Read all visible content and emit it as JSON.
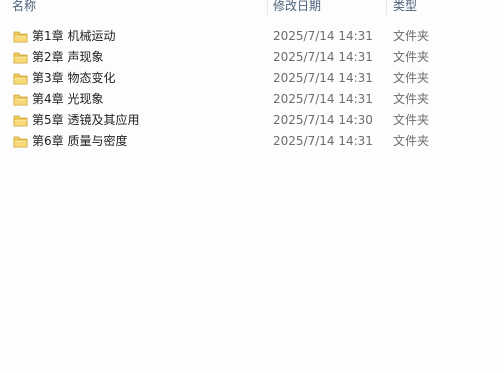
{
  "columns": {
    "name": "名称",
    "date": "修改日期",
    "type": "类型"
  },
  "icons": {
    "folder": "folder-icon"
  },
  "colors": {
    "folder_body": "#f3cf62",
    "folder_edge": "#c9a230",
    "header_text": "#4c607a"
  },
  "files": [
    {
      "name": "第1章 机械运动",
      "date": "2025/7/14 14:31",
      "type": "文件夹"
    },
    {
      "name": "第2章 声现象",
      "date": "2025/7/14 14:31",
      "type": "文件夹"
    },
    {
      "name": "第3章 物态变化",
      "date": "2025/7/14 14:31",
      "type": "文件夹"
    },
    {
      "name": "第4章 光现象",
      "date": "2025/7/14 14:31",
      "type": "文件夹"
    },
    {
      "name": "第5章 透镜及其应用",
      "date": "2025/7/14 14:30",
      "type": "文件夹"
    },
    {
      "name": "第6章 质量与密度",
      "date": "2025/7/14 14:31",
      "type": "文件夹"
    }
  ]
}
